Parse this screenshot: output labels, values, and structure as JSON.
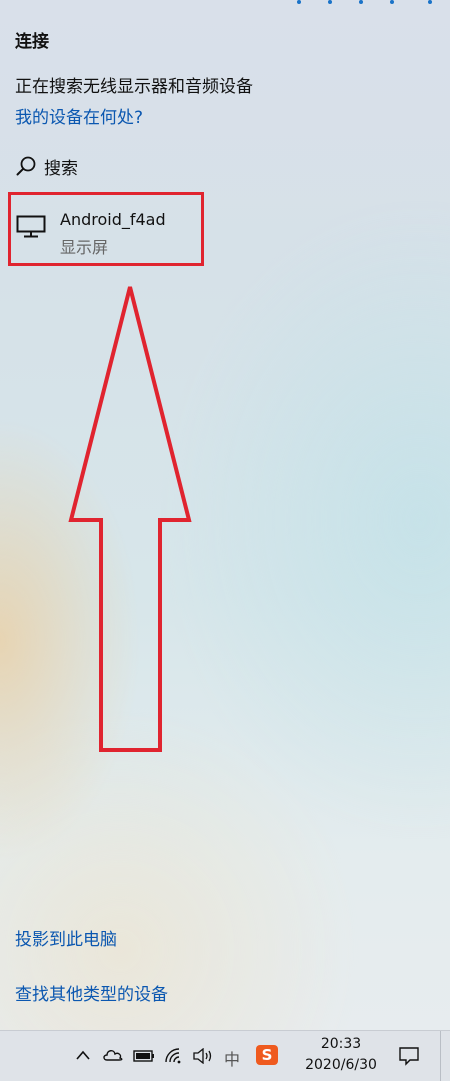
{
  "panel": {
    "title": "连接",
    "subtitle": "正在搜索无线显示器和音频设备",
    "where_link": "我的设备在何处?",
    "search_label": "搜索"
  },
  "devices": [
    {
      "name": "Android_f4ad",
      "type": "显示屏",
      "icon": "monitor-icon"
    }
  ],
  "footer_links": {
    "cast": "投影到此电脑",
    "find_other": "查找其他类型的设备"
  },
  "taskbar": {
    "ime": "中",
    "sogou": "S",
    "time": "20:33",
    "date": "2020/6/30",
    "icons": [
      "chevron-up-icon",
      "onedrive-cloud-icon",
      "battery-icon",
      "wifi-icon",
      "volume-icon",
      "action-center-icon"
    ]
  },
  "colors": {
    "link": "#0b57b0",
    "highlight": "#e0242f",
    "accent": "#1a73c8",
    "sogou": "#ef5a1e"
  }
}
